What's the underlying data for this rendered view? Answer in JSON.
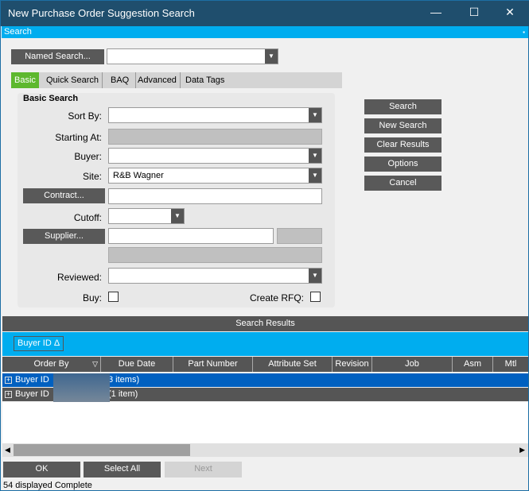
{
  "window": {
    "title": "New Purchase Order Suggestion Search",
    "minimize": "—",
    "maximize": "☐",
    "close": "✕"
  },
  "strip": {
    "title": "Search",
    "pin": "📌"
  },
  "named_search": {
    "button": "Named Search...",
    "value": ""
  },
  "tabs": [
    "Basic",
    "Quick Search",
    "BAQ",
    "Advanced",
    "Data Tags"
  ],
  "basic": {
    "title": "Basic Search",
    "sort_by": "Sort By:",
    "starting_at": "Starting At:",
    "buyer": "Buyer:",
    "site": "Site:",
    "site_value": "R&B Wagner",
    "contract": "Contract...",
    "cutoff": "Cutoff:",
    "supplier": "Supplier...",
    "reviewed": "Reviewed:",
    "buy": "Buy:",
    "create_rfq": "Create RFQ:"
  },
  "actions": [
    "Search",
    "New Search",
    "Clear Results",
    "Options",
    "Cancel"
  ],
  "results": {
    "title": "Search Results",
    "group_chip": "Buyer ID",
    "group_arrow": "Δ",
    "columns": [
      "Order By",
      "Due Date",
      "Part Number",
      "Attribute Set",
      "Revision",
      "Job",
      "Asm",
      "Mtl"
    ],
    "rows": [
      {
        "label": "Buyer ID",
        "count": "3 items)"
      },
      {
        "label": "Buyer ID",
        "count": "(1 item)"
      }
    ]
  },
  "footer": {
    "ok": "OK",
    "select_all": "Select All",
    "next": "Next",
    "status": "54 displayed Complete"
  }
}
